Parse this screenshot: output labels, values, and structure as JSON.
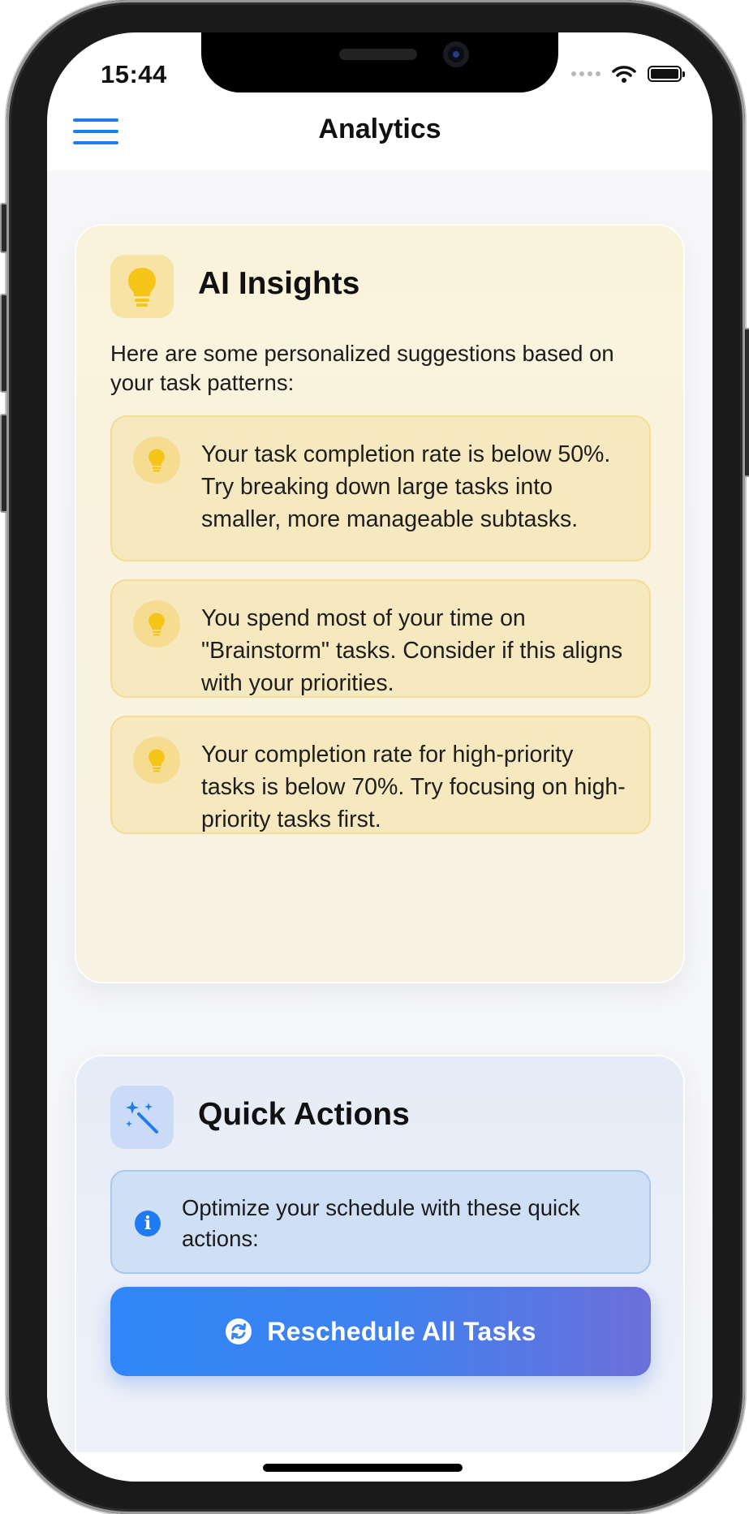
{
  "status_bar": {
    "time": "15:44"
  },
  "header": {
    "title": "Analytics",
    "menu_icon": "hamburger-menu-icon"
  },
  "ai_insights": {
    "icon": "lightbulb-icon",
    "title": "AI Insights",
    "description": "Here are some personalized suggestions based on your task patterns:",
    "tips": [
      {
        "icon": "lightbulb-icon",
        "text": "Your task completion rate is below 50%. Try breaking down large tasks into smaller, more manageable subtasks."
      },
      {
        "icon": "lightbulb-icon",
        "text": "You spend most of your time on \"Brainstorm\" tasks. Consider if this aligns with your priorities."
      },
      {
        "icon": "lightbulb-icon",
        "text": "Your completion rate for high-priority tasks is below 70%. Try focusing on high-priority tasks first."
      }
    ]
  },
  "quick_actions": {
    "icon": "magic-wand-icon",
    "title": "Quick Actions",
    "info": {
      "icon": "info-icon",
      "text": "Optimize your schedule with these quick actions:"
    },
    "primary_button": {
      "icon": "refresh-icon",
      "label": "Reschedule All Tasks"
    }
  },
  "colors": {
    "accent": "#1F7CF0",
    "insight_background": "#F6E8BF",
    "insight_border": "#F4DC93",
    "bulb_yellow": "#F5C518",
    "info_background": "#CFDFF5",
    "button_gradient_start": "#2F86F7",
    "button_gradient_end": "#6C6FDA"
  }
}
